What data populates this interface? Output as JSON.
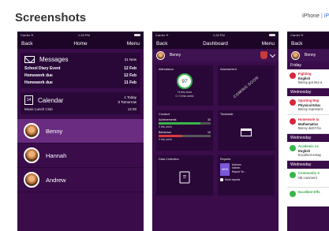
{
  "page": {
    "title": "Screenshots"
  },
  "device_toggle": {
    "iphone": "iPhone",
    "separator": "|",
    "ipad": "iP"
  },
  "status": {
    "carrier": "Carrier ✈",
    "time": "1:28 PM"
  },
  "home": {
    "nav": {
      "back": "Back",
      "title": "Home",
      "menu": "Menu"
    },
    "messages": {
      "title": "Messages",
      "count": "21 New",
      "rows": [
        {
          "label": "School Diary Event",
          "date": "12 Feb"
        },
        {
          "label": "Homework due",
          "date": "12 Feb"
        },
        {
          "label": "Homework due",
          "date": "11 Feb"
        }
      ]
    },
    "calendar": {
      "icon_text": "14",
      "title": "Calendar",
      "today": "1 Today",
      "tomorrow": "0 Tomorrow",
      "event": "Music Lunch Club",
      "event_time": "12:30"
    },
    "children": [
      "Benny",
      "Hannah",
      "Andrew"
    ]
  },
  "dashboard": {
    "nav": {
      "back": "Back",
      "title": "Dashboard",
      "menu": "Menu"
    },
    "user": "Benny",
    "attendance": {
      "label": "Attendance",
      "value": "97",
      "line1": "% this term",
      "line2": "0 / 0 this week"
    },
    "assessment": {
      "label": "Assessment",
      "stamp": "COMING SOON"
    },
    "conduct": {
      "label": "Conduct",
      "achievements_label": "Achievements",
      "achievements_value": "30",
      "achievements_sub": "0 this week",
      "behaviour_label": "Behaviour",
      "behaviour_value": "10",
      "behaviour_sub": "0 this week"
    },
    "timetable": {
      "label": "Timetable"
    },
    "data_collection": {
      "label": "Data Collection"
    },
    "reports": {
      "label": "Reports",
      "thumb": "NEW",
      "line1": "Autumn",
      "line2": "Interim",
      "line3": "Report Ye...",
      "more": "More reports"
    }
  },
  "messages_list": {
    "nav": {
      "back": "Back"
    },
    "user": "Benny",
    "groups": [
      {
        "day": "Friday",
        "items": [
          {
            "color": "red",
            "title": "Fighting",
            "subject": "English",
            "body": "Benny got into a"
          }
        ]
      },
      {
        "day": "Wednesday",
        "items": [
          {
            "color": "red",
            "title": "Sporting Rep",
            "subject": "Physical Educ",
            "body": "Benny represent"
          },
          {
            "color": "red",
            "title": "Homework la",
            "subject": "Mathematics",
            "body": "Benny didn't ha"
          }
        ]
      },
      {
        "day": "Wednesday",
        "items": [
          {
            "color": "green",
            "title": "Academic Ac",
            "subject": "English",
            "body": "Excellent essay"
          }
        ]
      },
      {
        "day": "Wednesday",
        "items": [
          {
            "color": "green",
            "title": "Community S",
            "subject": "",
            "body": "Nb comment"
          },
          {
            "color": "green",
            "title": "Excellent Effo",
            "subject": "",
            "body": ""
          }
        ]
      }
    ]
  },
  "colors": {
    "purple_dark": "#3a0c4a",
    "purple_selected": "#6a2c80",
    "green": "#39b54a",
    "red": "#d7263d"
  }
}
